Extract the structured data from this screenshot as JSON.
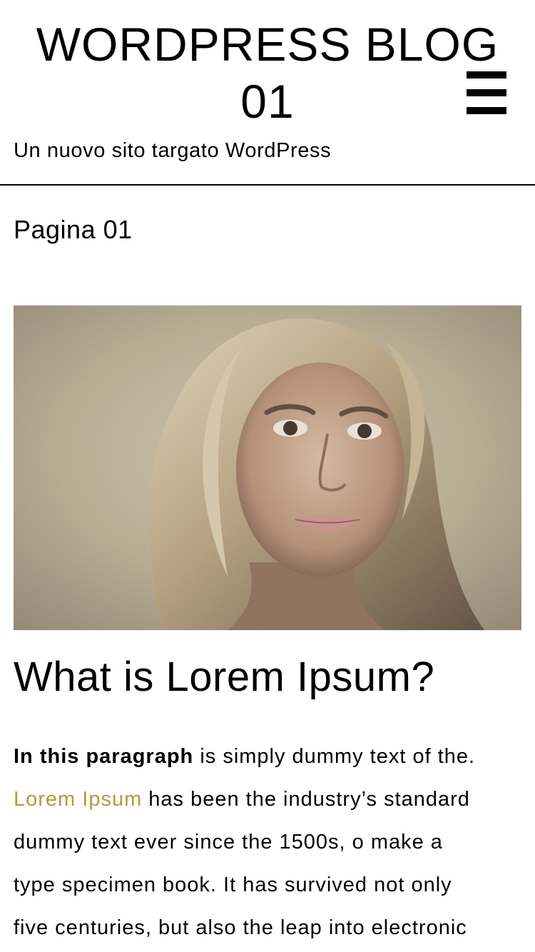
{
  "header": {
    "title_line1": "WORDPRESS BLOG",
    "title_line2": "01",
    "tagline": "Un nuovo sito targato WordPress",
    "menu_icon": "hamburger-menu-icon"
  },
  "page": {
    "title": "Pagina 01"
  },
  "article": {
    "image_alt": "Portrait of a young woman with long blond hair and freckles",
    "heading": "What is Lorem Ipsum?",
    "paragraph": {
      "bold_lead": "In this paragraph",
      "line1_rest": " is simply dummy text of the.",
      "link_text": "Lorem Ipsum",
      "line2_rest": " has been the industry’s standard",
      "line3": "dummy text ever since the 1500s, o make a",
      "line4": "type specimen book. It has survived not only",
      "line5": "five centuries, but also the leap into electronic"
    }
  },
  "colors": {
    "link": "#b8973f",
    "text": "#000000",
    "background": "#ffffff"
  }
}
